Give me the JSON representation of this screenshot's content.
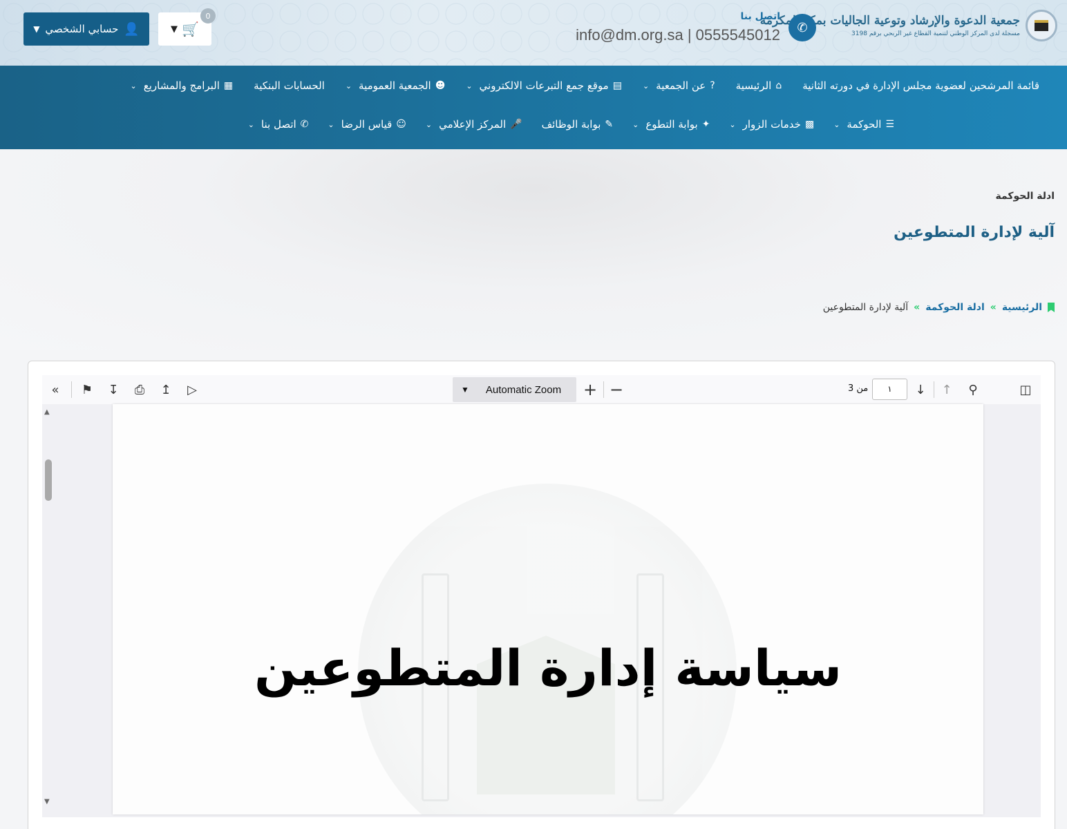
{
  "header": {
    "org_name": "جمعية الدعوة والإرشاد وتوعية الجاليات بمكة المكرمة",
    "org_sub": "مسجلة لدى المركز الوطني لتنمية القطاع غير الربحي برقم 3198",
    "contact_label": "اتصل بنا",
    "contact_line": "info@dm.org.sa | 0555545012",
    "cart_count": "0",
    "account_label": "حسابي الشخصي"
  },
  "nav": {
    "row1": [
      {
        "label": "قائمة المرشحين لعضوية مجلس الإدارة في دورته الثانية",
        "icon": "none",
        "dropdown": false
      },
      {
        "label": "الرئيسية",
        "icon": "home-icon",
        "dropdown": false
      },
      {
        "label": "عن الجمعية",
        "icon": "question-icon",
        "dropdown": true
      },
      {
        "label": "موقع جمع التبرعات الالكتروني",
        "icon": "card-icon",
        "dropdown": true
      },
      {
        "label": "الجمعية العمومية",
        "icon": "users-icon",
        "dropdown": true
      },
      {
        "label": "الحسابات البنكية",
        "icon": "none",
        "dropdown": false
      },
      {
        "label": "البرامج والمشاريع",
        "icon": "calendar-icon",
        "dropdown": true
      }
    ],
    "row2": [
      {
        "label": "الحوكمة",
        "icon": "list-icon",
        "dropdown": true
      },
      {
        "label": "خدمات الزوار",
        "icon": "server-icon",
        "dropdown": true
      },
      {
        "label": "بوابة التطوع",
        "icon": "person-icon",
        "dropdown": true
      },
      {
        "label": "بوابة الوظائف",
        "icon": "edit-icon",
        "dropdown": false
      },
      {
        "label": "المركز الإعلامي",
        "icon": "mic-icon",
        "dropdown": true
      },
      {
        "label": "قياس الرضا",
        "icon": "smile-icon",
        "dropdown": true
      },
      {
        "label": "اتصل بنا",
        "icon": "phone-icon",
        "dropdown": true
      }
    ]
  },
  "hero": {
    "section_label": "ادلة الحوكمة",
    "title": "آلية لإدارة المتطوعين",
    "breadcrumb": {
      "home": "الرئيسية",
      "parent": "ادلة الحوكمة",
      "current": "آلية لإدارة المتطوعين",
      "separator": "»"
    }
  },
  "viewer": {
    "zoom": "Automatic Zoom",
    "page_number": "١",
    "page_of": "من 3",
    "document_heading": "سياسة إدارة المتطوعين"
  }
}
